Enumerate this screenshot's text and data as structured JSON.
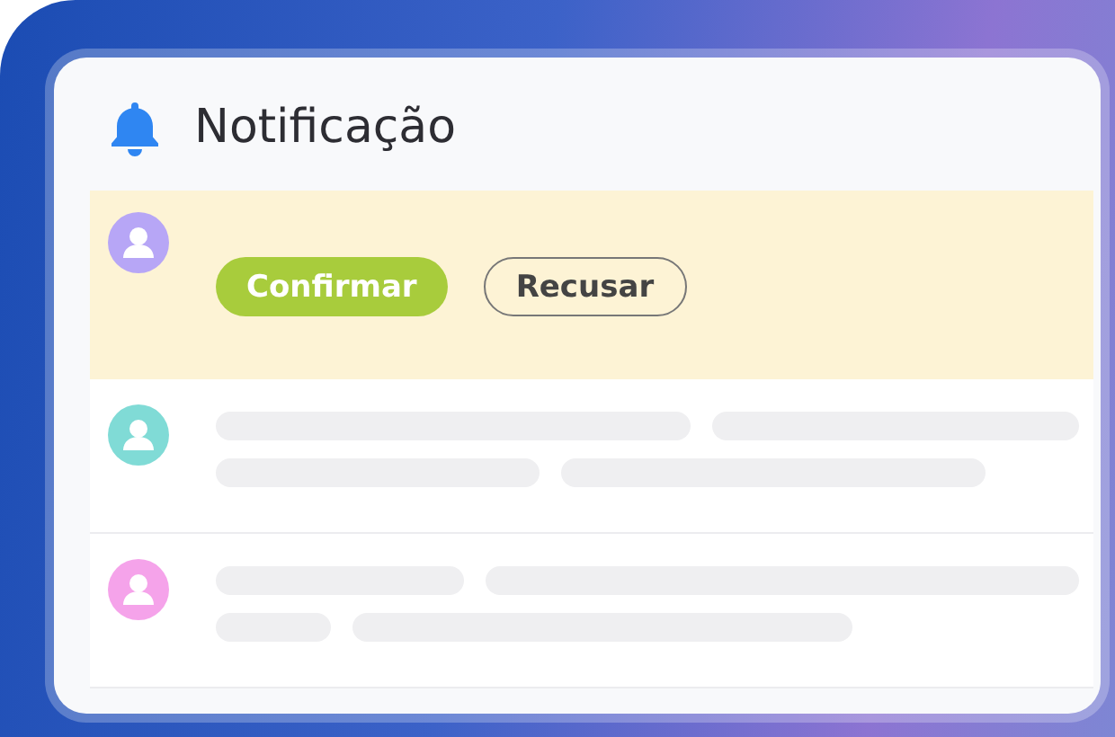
{
  "header": {
    "title": "Notificação"
  },
  "notifications": [
    {
      "kind": "request",
      "highlighted": true,
      "color": "#b7a6f6",
      "buttons": [
        {
          "label": "Confirmar",
          "kind": "primary"
        },
        {
          "label": "Recusar",
          "kind": "outline"
        }
      ]
    },
    {
      "kind": "loading",
      "highlighted": false,
      "color": "#80dbd6"
    },
    {
      "kind": "loading",
      "highlighted": false,
      "color": "#f5a3ea"
    }
  ]
}
